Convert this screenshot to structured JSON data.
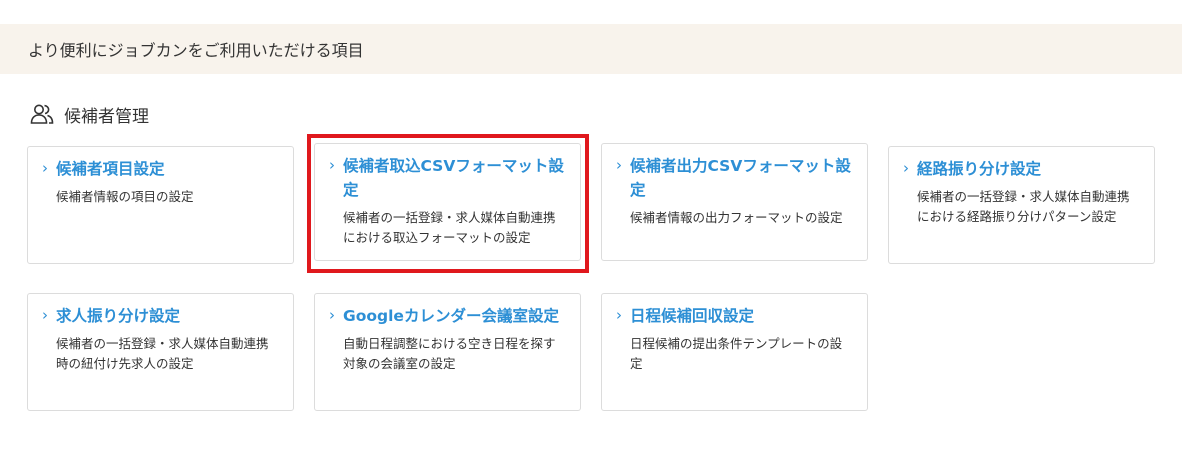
{
  "banner": {
    "text": "より便利にジョブカンをご利用いただける項目"
  },
  "section": {
    "title": "候補者管理",
    "icon": "users-icon"
  },
  "cards": [
    {
      "title": "候補者項目設定",
      "desc": "候補者情報の項目の設定"
    },
    {
      "title": "候補者取込CSVフォーマット設定",
      "desc": "候補者の一括登録・求人媒体自動連携における取込フォーマットの設定"
    },
    {
      "title": "候補者出力CSVフォーマット設定",
      "desc": "候補者情報の出力フォーマットの設定"
    },
    {
      "title": "経路振り分け設定",
      "desc": "候補者の一括登録・求人媒体自動連携における経路振り分けパターン設定"
    },
    {
      "title": "求人振り分け設定",
      "desc": "候補者の一括登録・求人媒体自動連携時の紐付け先求人の設定"
    },
    {
      "title": "Googleカレンダー会議室設定",
      "desc": "自動日程調整における空き日程を探す対象の会議室の設定"
    },
    {
      "title": "日程候補回収設定",
      "desc": "日程候補の提出条件テンプレートの設定"
    }
  ],
  "chevron": "›",
  "colors": {
    "accent": "#2d8fd5",
    "banner_bg": "#f8f3ec",
    "highlight": "#e0181d"
  }
}
